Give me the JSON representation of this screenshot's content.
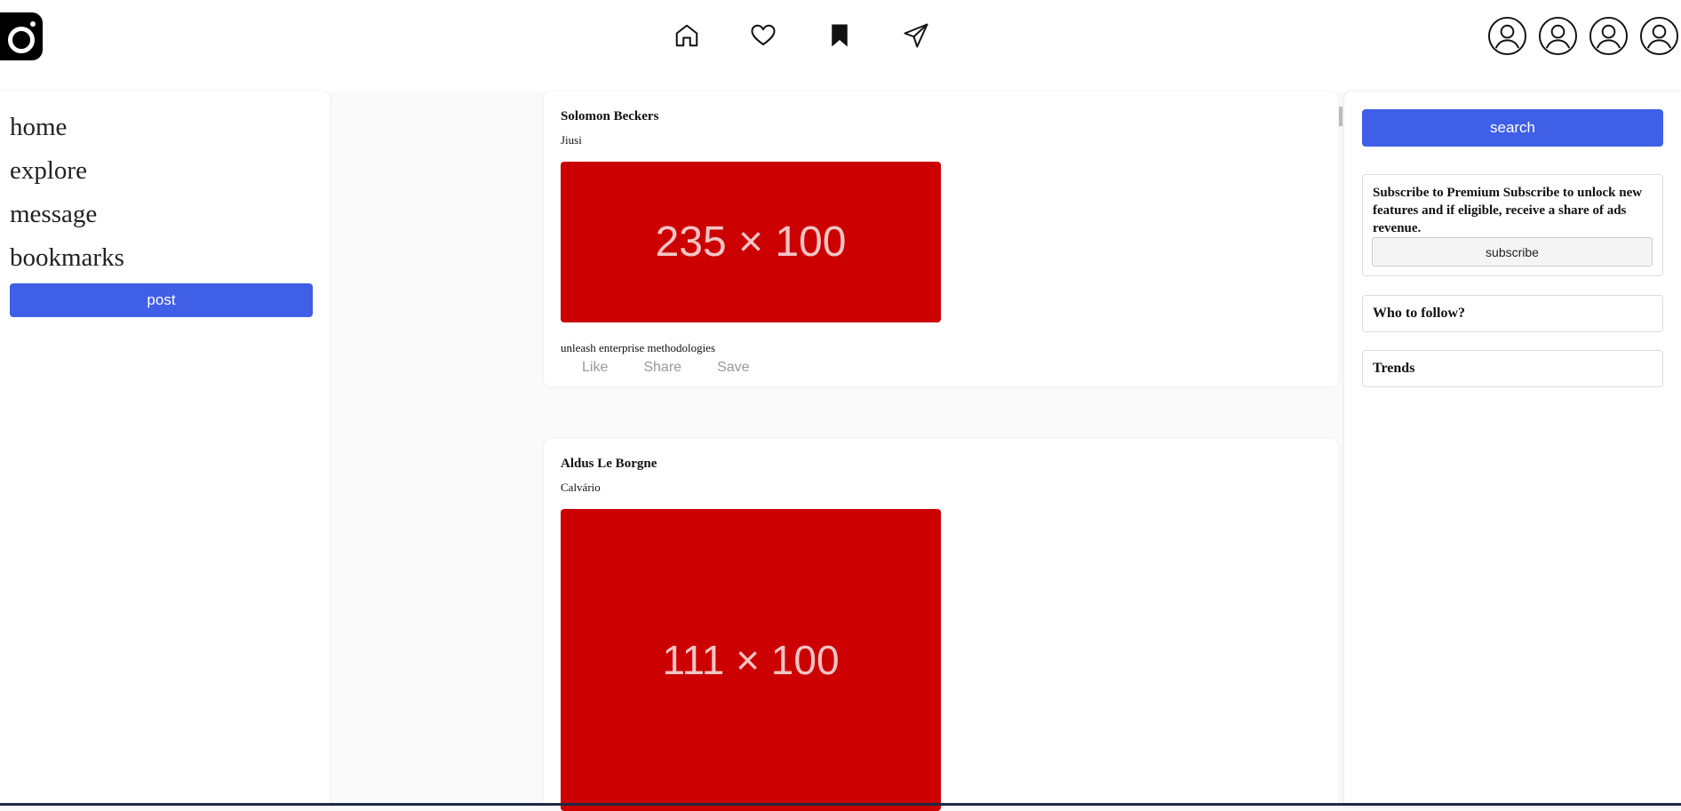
{
  "header": {
    "logo_icon": "instagram-logo-icon",
    "nav_icons": [
      "home-icon",
      "heart-icon",
      "bookmark-icon",
      "send-icon"
    ],
    "avatar_icon": "user-avatar-icon"
  },
  "sidebar": {
    "items": [
      {
        "label": "home"
      },
      {
        "label": "explore"
      },
      {
        "label": "message"
      },
      {
        "label": "bookmarks"
      }
    ],
    "post_label": "post"
  },
  "feed": {
    "posts": [
      {
        "author": "Solomon Beckers",
        "location": "Jiusi",
        "image_text": "235 × 100",
        "caption": "unleash enterprise methodologies",
        "actions": [
          "Like",
          "Share",
          "Save"
        ]
      },
      {
        "author": "Aldus Le Borgne",
        "location": "Calvário",
        "image_text": "111 × 100"
      }
    ]
  },
  "right": {
    "search_label": "search",
    "premium_text": "Subscribe to Premium Subscribe to unlock new features and if eligible, receive a share of ads revenue.",
    "subscribe_label": "subscribe",
    "follow_title": "Who to follow?",
    "trends_title": "Trends"
  },
  "colors": {
    "accent": "#3f5fe6",
    "placeholder_red": "#cc0000"
  }
}
